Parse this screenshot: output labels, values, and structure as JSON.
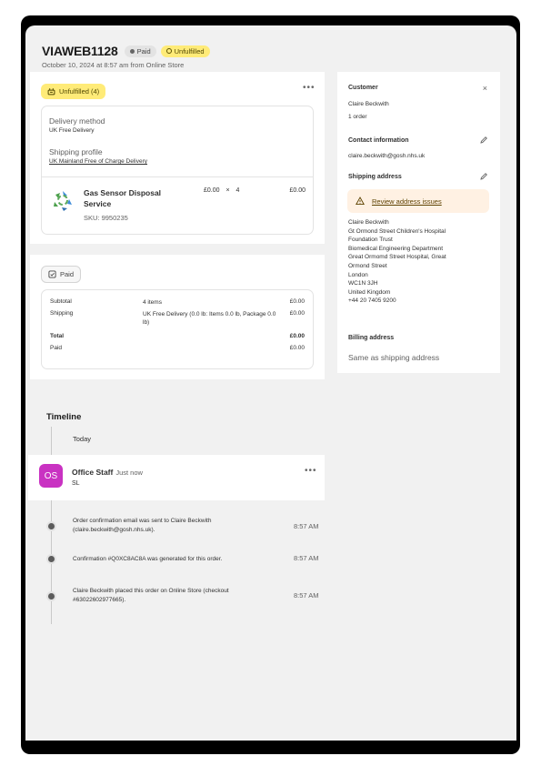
{
  "order": {
    "id": "VIAWEB1128",
    "payment_badge": "Paid",
    "fulfillment_badge": "Unfulfilled",
    "subtitle": "October 10, 2024 at 8:57 am from Online Store"
  },
  "fulfillment": {
    "badge": "Unfulfilled (4)",
    "more": "•••",
    "delivery_method_label": "Delivery method",
    "delivery_method_value": "UK Free Delivery",
    "shipping_profile_label": "Shipping profile",
    "shipping_profile_value": "UK Mainland Free of Charge Delivery",
    "product": {
      "name": "Gas Sensor Disposal Service",
      "sku": "SKU: 9950235",
      "unit_price": "£0.00",
      "times": "×",
      "quantity": "4",
      "total": "£0.00"
    }
  },
  "payment": {
    "badge": "Paid",
    "rows": [
      {
        "label": "Subtotal",
        "detail": "4 items",
        "amount": "£0.00"
      },
      {
        "label": "Shipping",
        "detail": "UK Free Delivery (0.0 lb: Items 0.0 lb, Package 0.0 lb)",
        "amount": "£0.00"
      },
      {
        "label": "Total",
        "detail": "",
        "amount": "£0.00"
      },
      {
        "label": "Paid",
        "detail": "",
        "amount": "£0.00"
      }
    ]
  },
  "customer": {
    "heading": "Customer",
    "close": "×",
    "name": "Claire Beckwith",
    "orders": "1 order",
    "contact_heading": "Contact information",
    "email": "claire.beckwith@gosh.nhs.uk",
    "shipping_heading": "Shipping address",
    "warning": "Review address issues",
    "address_lines": [
      "Claire Beckwith",
      "Gt Ormond Street Children's Hospital",
      "Foundation Trust",
      "Biomedical Engineering Department",
      "Great Ormomd Street Hospital, Great",
      "Ormond Street",
      "London",
      "WC1N 3JH",
      "United Kingdom",
      "+44 20 7405 9200"
    ],
    "billing_heading": "Billing address",
    "billing_value": "Same as shipping address"
  },
  "timeline": {
    "title": "Timeline",
    "today": "Today",
    "staff": {
      "initials": "OS",
      "name": "Office Staff",
      "time": "Just now",
      "note": "SL",
      "more": "•••"
    },
    "events": [
      {
        "text": "Order confirmation email was sent to Claire Beckwith (claire.beckwith@gosh.nhs.uk).",
        "time": "8:57 AM"
      },
      {
        "text": "Confirmation #Q0XC8AC8A was generated for this order.",
        "time": "8:57 AM"
      },
      {
        "text": "Claire Beckwith placed this order on Online Store (checkout #63022602977665).",
        "time": "8:57 AM"
      }
    ]
  },
  "colors": {
    "unfulfilled_bg": "#ffeb78",
    "avatar": "#c932c2",
    "warning_bg": "#fff1e3"
  }
}
